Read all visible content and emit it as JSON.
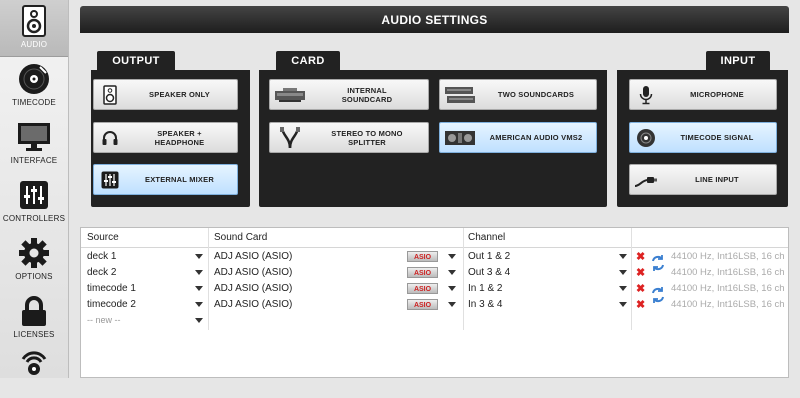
{
  "sidebar": {
    "items": [
      {
        "label": "AUDIO",
        "icon": "speaker-icon",
        "active": true
      },
      {
        "label": "TIMECODE",
        "icon": "vinyl-icon",
        "active": false
      },
      {
        "label": "INTERFACE",
        "icon": "monitor-icon",
        "active": false
      },
      {
        "label": "CONTROLLERS",
        "icon": "sliders-icon",
        "active": false
      },
      {
        "label": "OPTIONS",
        "icon": "gear-icon",
        "active": false
      },
      {
        "label": "LICENSES",
        "icon": "lock-icon",
        "active": false
      },
      {
        "label": "",
        "icon": "broadcast-icon",
        "active": false
      }
    ]
  },
  "header": {
    "title": "AUDIO SETTINGS"
  },
  "output": {
    "title": "OUTPUT",
    "options": [
      {
        "label": "SPEAKER ONLY",
        "icon": "speaker-icon",
        "selected": false
      },
      {
        "label": "SPEAKER +\nHEADPHONE",
        "icon": "headphone-icon",
        "selected": false
      },
      {
        "label": "EXTERNAL MIXER",
        "icon": "mixer-icon",
        "selected": true
      }
    ]
  },
  "card": {
    "title": "CARD",
    "options": [
      {
        "label": "INTERNAL\nSOUNDCARD",
        "icon": "soundcard-icon",
        "selected": false
      },
      {
        "label": "TWO SOUNDCARDS",
        "icon": "two-soundcards-icon",
        "selected": false
      },
      {
        "label": "STEREO TO MONO\nSPLITTER",
        "icon": "splitter-cable-icon",
        "selected": false
      },
      {
        "label": "AMERICAN AUDIO VMS2",
        "icon": "controller-icon",
        "selected": true
      }
    ]
  },
  "input": {
    "title": "INPUT",
    "options": [
      {
        "label": "MICROPHONE",
        "icon": "microphone-icon",
        "selected": false
      },
      {
        "label": "TIMECODE SIGNAL",
        "icon": "cd-icon",
        "selected": true
      },
      {
        "label": "LINE INPUT",
        "icon": "cable-icon",
        "selected": false
      }
    ]
  },
  "table": {
    "headers": {
      "source": "Source",
      "soundcard": "Sound Card",
      "channel": "Channel"
    },
    "rows": [
      {
        "source": "deck 1",
        "card": "ADJ ASIO (ASIO)",
        "asio": "ASIO",
        "channel": "Out 1 & 2",
        "info": "44100 Hz, Int16LSB, 16 ch"
      },
      {
        "source": "deck 2",
        "card": "ADJ ASIO (ASIO)",
        "asio": "ASIO",
        "channel": "Out 3 & 4",
        "info": "44100 Hz, Int16LSB, 16 ch"
      },
      {
        "source": "timecode 1",
        "card": "ADJ ASIO (ASIO)",
        "asio": "ASIO",
        "channel": "In 1 & 2",
        "info": "44100 Hz, Int16LSB, 16 ch"
      },
      {
        "source": "timecode 2",
        "card": "ADJ ASIO (ASIO)",
        "asio": "ASIO",
        "channel": "In 3 & 4",
        "info": "44100 Hz, Int16LSB, 16 ch"
      }
    ],
    "new_row": {
      "source": "-- new --"
    },
    "remove_symbol": "✖"
  },
  "colors": {
    "panel": "#222222",
    "selected": "#bfe0ff",
    "remove": "#dd2222",
    "refresh": "#3a7fd0"
  }
}
